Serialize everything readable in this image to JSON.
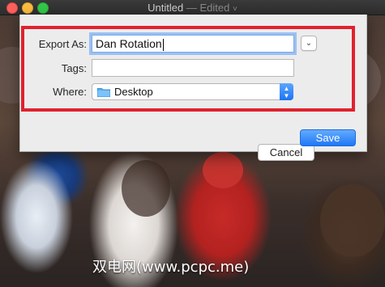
{
  "window": {
    "title": "Untitled",
    "status": " — Edited",
    "chevron": "˅"
  },
  "dialog": {
    "export_as_label": "Export As:",
    "export_as_value": "Dan Rotation",
    "tags_label": "Tags:",
    "tags_value": "",
    "where_label": "Where:",
    "where_value": "Desktop",
    "expand_icon": "chevron-down-icon",
    "cancel_label": "Cancel",
    "save_label": "Save"
  },
  "colors": {
    "accent": "#1f77f5",
    "highlight": "#e0222e"
  },
  "watermark": {
    "text": "双电网(www.pcpc.me)"
  }
}
